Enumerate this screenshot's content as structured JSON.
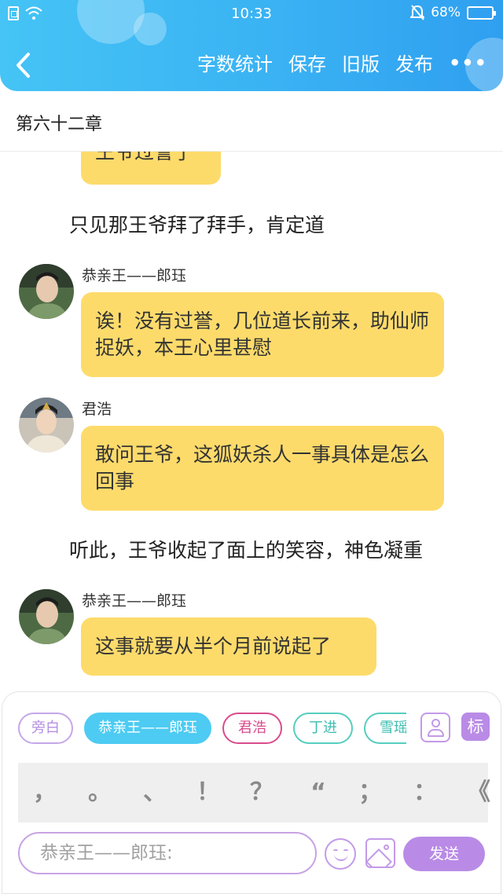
{
  "status_bar": {
    "time": "10:33",
    "battery": "68%",
    "battery_level": 0.68
  },
  "header": {
    "actions": [
      "字数统计",
      "保存",
      "旧版",
      "发布"
    ],
    "more": "•••"
  },
  "chapter": {
    "title": "第六十二章"
  },
  "messages": [
    {
      "text": "王爷过誉了"
    },
    {
      "narration": "只见那王爷拜了拜手，肯定道"
    },
    {
      "speaker": "恭亲王——郎珏",
      "text": "诶！没有过誉，几位道长前来，助仙师捉妖，本王心里甚慰"
    },
    {
      "speaker": "君浩",
      "text": "敢问王爷，这狐妖杀人一事具体是怎么回事"
    },
    {
      "narration": "听此，王爷收起了面上的笑容，神色凝重"
    },
    {
      "speaker": "恭亲王——郎珏",
      "text": "这事就要从半个月前说起了"
    }
  ],
  "roles": {
    "chips": [
      "旁白",
      "恭亲王——郎珏",
      "君浩",
      "丁进",
      "雪瑶"
    ],
    "selected": "恭亲王——郎珏",
    "mark_label": "标"
  },
  "punctuation": [
    "，",
    "。",
    "、",
    "！",
    "？",
    "“",
    "；",
    "：",
    "《"
  ],
  "composer": {
    "placeholder": "恭亲王——郎珏:",
    "send_label": "发送"
  }
}
